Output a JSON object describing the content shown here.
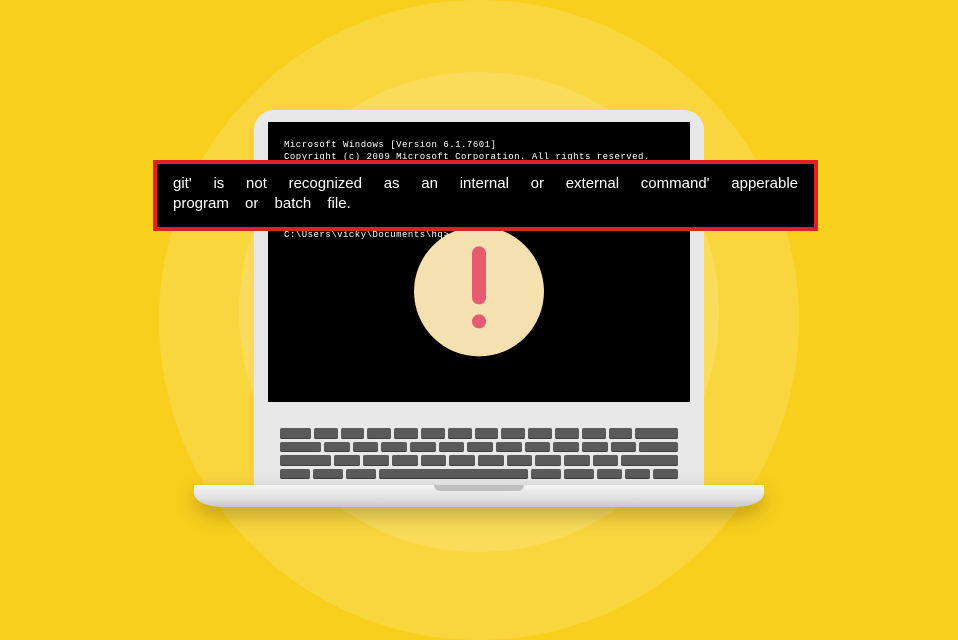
{
  "terminal": {
    "version_line": "Microsoft Windows [Version 6.1.7601]",
    "copyright_line": "Copyright (c) 2009 Microsoft Corporation. All rights reserved.",
    "prompt": "C:\\Users\\vicky\\Documents\\hq>"
  },
  "error": {
    "message": "git' is not recognized as an internal or external command' apperable program or batch file."
  },
  "icons": {
    "warning": "!"
  }
}
